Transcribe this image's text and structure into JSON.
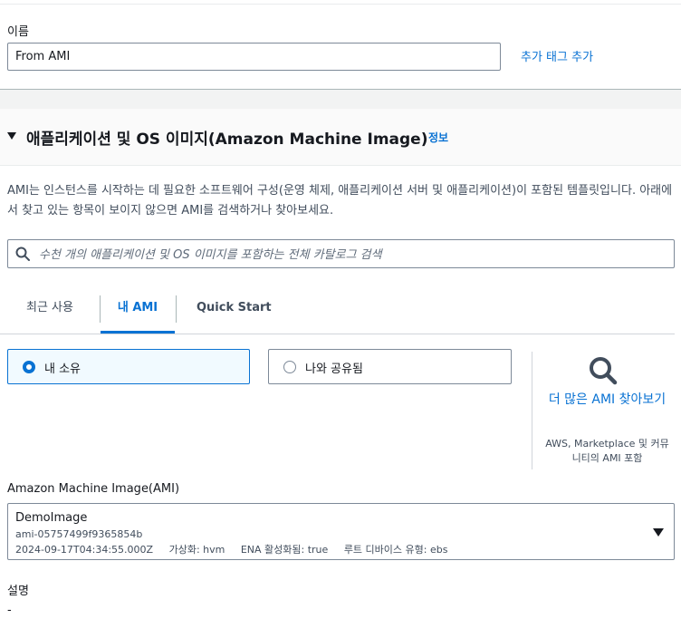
{
  "name_field": {
    "label": "이름",
    "value": "From AMI",
    "add_tag_label": "추가 태그 추가"
  },
  "section": {
    "title": "애플리케이션 및 OS 이미지(Amazon Machine Image)",
    "info_label": "정보",
    "description": "AMI는 인스턴스를 시작하는 데 필요한 소프트웨어 구성(운영 체제, 애플리케이션 서버 및 애플리케이션)이 포함된 템플릿입니다. 아래에서 찾고 있는 항목이 보이지 않으면 AMI를 검색하거나 찾아보세요."
  },
  "search": {
    "placeholder": "수천 개의 애플리케이션 및 OS 이미지를 포함하는 전체 카탈로그 검색",
    "icon": "search-icon"
  },
  "tabs": [
    {
      "label": "최근 사용",
      "selected": false
    },
    {
      "label": "내 AMI",
      "selected": true
    },
    {
      "label": "Quick Start",
      "selected": false
    }
  ],
  "ownership_options": [
    {
      "label": "내 소유",
      "selected": true
    },
    {
      "label": "나와 공유됨",
      "selected": false
    }
  ],
  "browse_more": {
    "icon": "magnifier-icon",
    "link": "더 많은 AMI 찾아보기",
    "sub": "AWS, Marketplace 및 커뮤니티의 AMI 포함"
  },
  "ami_select": {
    "label": "Amazon Machine Image(AMI)",
    "name": "DemoImage",
    "id": "ami-05757499f9365854b",
    "created": "2024-09-17T04:34:55.000Z",
    "virtualization": "가상화: hvm",
    "ena": "ENA 활성화됨: true",
    "root_device": "루트 디바이스 유형: ebs"
  },
  "description_field": {
    "label": "설명",
    "value": "-"
  },
  "colors": {
    "accent": "#0972d3",
    "selected_bg": "#f1faff",
    "border": "#7d8998"
  }
}
